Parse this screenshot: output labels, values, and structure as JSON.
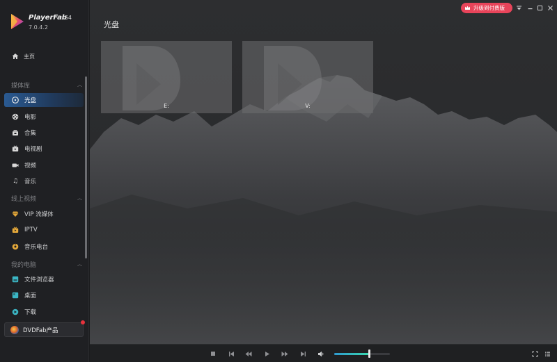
{
  "app": {
    "name": "PlayerFab",
    "arch": "x64",
    "version": "7.0.4.2"
  },
  "sidebar": {
    "home": {
      "label": "主页",
      "icon": "home-icon"
    },
    "sections": [
      {
        "title": "媒体库",
        "items": [
          {
            "label": "光盘",
            "icon": "disc-icon",
            "active": true
          },
          {
            "label": "电影",
            "icon": "film-reel-icon"
          },
          {
            "label": "合集",
            "icon": "collection-icon"
          },
          {
            "label": "电视剧",
            "icon": "tv-icon"
          },
          {
            "label": "视频",
            "icon": "video-camera-icon"
          },
          {
            "label": "音乐",
            "icon": "music-note-icon"
          }
        ]
      },
      {
        "title": "线上视频",
        "items": [
          {
            "label": "VIP 流媒体",
            "icon": "diamond-icon"
          },
          {
            "label": "IPTV",
            "icon": "iptv-icon"
          },
          {
            "label": "音乐电台",
            "icon": "radio-icon"
          }
        ]
      },
      {
        "title": "我的电脑",
        "items": [
          {
            "label": "文件浏览器",
            "icon": "folder-icon"
          },
          {
            "label": "桌面",
            "icon": "desktop-icon"
          },
          {
            "label": "下载",
            "icon": "download-icon"
          }
        ]
      }
    ],
    "product_button": {
      "label": "DVDFab产品"
    }
  },
  "main": {
    "title": "光盘",
    "drives": [
      {
        "label": "E:"
      },
      {
        "label": "V:"
      }
    ]
  },
  "titlebar": {
    "upgrade_label": "升级到付费版"
  },
  "player": {
    "volume": 0.62
  },
  "colors": {
    "accent": "#2a5a92",
    "upgrade": "#e8445a",
    "notice": "#e8323c"
  }
}
